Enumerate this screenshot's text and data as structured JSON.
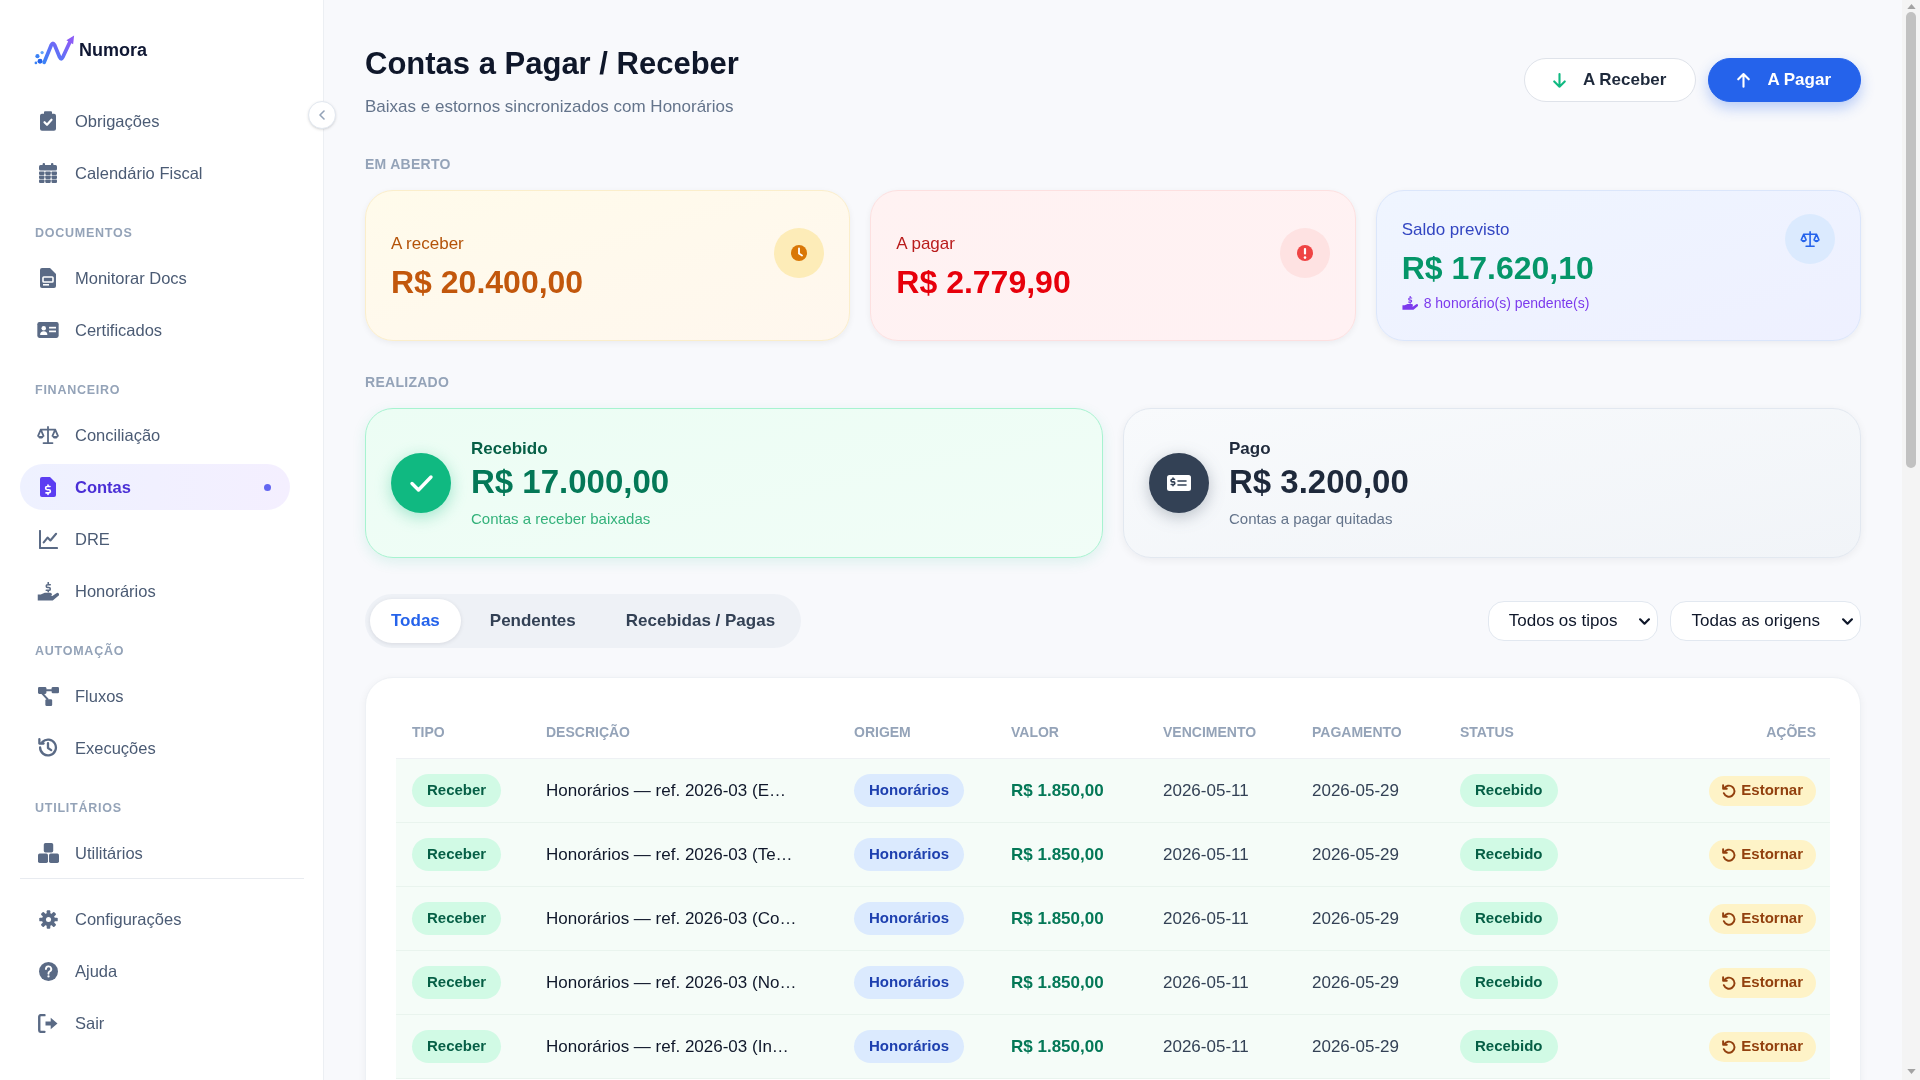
{
  "sidebar": {
    "brand": "Numora",
    "groups": [
      {
        "items": [
          {
            "label": "Obrigações",
            "selected": false
          },
          {
            "label": "Calendário Fiscal",
            "selected": false
          }
        ]
      },
      {
        "heading": "DOCUMENTOS",
        "items": [
          {
            "label": "Monitorar Docs",
            "selected": false
          },
          {
            "label": "Certificados",
            "selected": false
          }
        ]
      },
      {
        "heading": "FINANCEIRO",
        "items": [
          {
            "label": "Conciliação",
            "selected": false
          },
          {
            "label": "Contas",
            "selected": true
          },
          {
            "label": "DRE",
            "selected": false
          },
          {
            "label": "Honorários",
            "selected": false
          }
        ]
      },
      {
        "heading": "AUTOMAÇÃO",
        "items": [
          {
            "label": "Fluxos",
            "selected": false
          },
          {
            "label": "Execuções",
            "selected": false
          }
        ]
      },
      {
        "heading": "UTILITÁRIOS",
        "items": [
          {
            "label": "Utilitários",
            "selected": false
          }
        ]
      }
    ],
    "footer_items": [
      {
        "label": "Configurações",
        "selected": false
      },
      {
        "label": "Ajuda",
        "selected": false
      },
      {
        "label": "Sair",
        "selected": false
      }
    ]
  },
  "header": {
    "title": "Contas a Pagar / Receber",
    "subtitle": "Baixas e estornos sincronizados com Honorários",
    "actions": [
      {
        "kind": "secondary",
        "label": "A Receber"
      },
      {
        "kind": "primary",
        "label": "A Pagar"
      }
    ]
  },
  "open": {
    "heading": "EM ABERTO",
    "cards": [
      {
        "kind": "receivable",
        "label": "A receber",
        "value": "R$ 20.400,00"
      },
      {
        "kind": "payable",
        "label": "A pagar",
        "value": "R$ 2.779,90"
      },
      {
        "kind": "balance",
        "label": "Saldo previsto",
        "value": "R$ 17.620,10",
        "note": "8 honorário(s) pendente(s)"
      }
    ]
  },
  "realized": {
    "heading": "REALIZADO",
    "cards": [
      {
        "kind": "received",
        "label": "Recebido",
        "value": "R$ 17.000,00",
        "note": "Contas a receber baixadas"
      },
      {
        "kind": "paid",
        "label": "Pago",
        "value": "R$ 3.200,00",
        "note": "Contas a pagar quitadas"
      }
    ]
  },
  "filters": {
    "tabs": [
      {
        "label": "Todas",
        "selected": true
      },
      {
        "label": "Pendentes",
        "selected": false
      },
      {
        "label": "Recebidas / Pagas",
        "selected": false
      }
    ],
    "selects": [
      {
        "value": "Todos os tipos"
      },
      {
        "value": "Todas as origens"
      }
    ]
  },
  "table": {
    "columns": [
      "TIPO",
      "DESCRIÇÃO",
      "ORIGEM",
      "VALOR",
      "VENCIMENTO",
      "PAGAMENTO",
      "STATUS",
      "AÇÕES"
    ],
    "rows": [
      {
        "type": "Receber",
        "description": "Honorários — ref. 2026-03 (E…",
        "origin": "Honorários",
        "amount": "R$ 1.850,00",
        "due_date": "2026-05-11",
        "payment_date": "2026-05-29",
        "status": "Recebido",
        "action": "Estornar"
      },
      {
        "type": "Receber",
        "description": "Honorários — ref. 2026-03 (Te…",
        "origin": "Honorários",
        "amount": "R$ 1.850,00",
        "due_date": "2026-05-11",
        "payment_date": "2026-05-29",
        "status": "Recebido",
        "action": "Estornar"
      },
      {
        "type": "Receber",
        "description": "Honorários — ref. 2026-03 (Co…",
        "origin": "Honorários",
        "amount": "R$ 1.850,00",
        "due_date": "2026-05-11",
        "payment_date": "2026-05-29",
        "status": "Recebido",
        "action": "Estornar"
      },
      {
        "type": "Receber",
        "description": "Honorários — ref. 2026-03 (No…",
        "origin": "Honorários",
        "amount": "R$ 1.850,00",
        "due_date": "2026-05-11",
        "payment_date": "2026-05-29",
        "status": "Recebido",
        "action": "Estornar"
      },
      {
        "type": "Receber",
        "description": "Honorários — ref. 2026-03 (In…",
        "origin": "Honorários",
        "amount": "R$ 1.850,00",
        "due_date": "2026-05-11",
        "payment_date": "2026-05-29",
        "status": "Recebido",
        "action": "Estornar"
      }
    ]
  }
}
